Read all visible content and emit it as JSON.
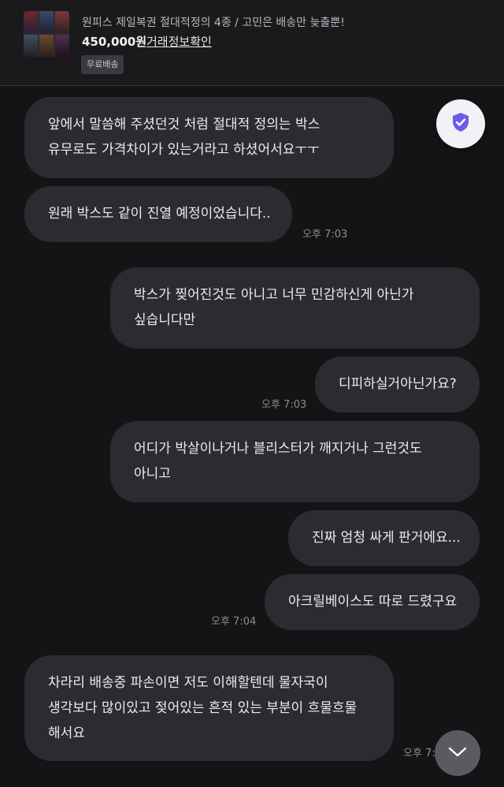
{
  "product": {
    "title": "원피스 제일복권 절대적정의 4종 / 고민은 배송만 늦출뿐!",
    "price": "450,000원",
    "transaction_link": "거래정보확인",
    "badge": "무료배송"
  },
  "messages": [
    {
      "side": "received",
      "lines": [
        "앞에서 말씀해 주셨던것 처럼 절대적 정의는 박스",
        "유무로도 가격차이가 있는거라고 하셨어서요ㅜㅜ"
      ]
    },
    {
      "side": "received",
      "lines": [
        "원래 박스도 같이 진열 예정이었습니다.."
      ],
      "time": "오후 7:03"
    },
    {
      "side": "sent",
      "lines": [
        "박스가 찢어진것도 아니고 너무 민감하신게 아닌가",
        "싶습니다만"
      ]
    },
    {
      "side": "sent",
      "lines": [
        "디피하실거아닌가요?"
      ],
      "time": "오후 7:03"
    },
    {
      "side": "sent",
      "lines": [
        "어디가 박살이나거나 블리스터가 깨지거나 그런것도",
        "아니고"
      ]
    },
    {
      "side": "sent",
      "lines": [
        "진짜 엄청 싸게 판거에요..."
      ]
    },
    {
      "side": "sent",
      "lines": [
        "아크릴베이스도 따로 드렸구요"
      ],
      "time": "오후 7:04"
    },
    {
      "side": "received",
      "lines": [
        "차라리 배송중 파손이면 저도 이해할텐데 물자국이",
        "생각보다 많이있고 젖어있는 흔적 있는 부분이 흐물흐물",
        "해서요"
      ],
      "time": "오후 7:"
    }
  ],
  "icons": {
    "safety": "shield-check-icon",
    "scroll_down": "chevron-down-icon"
  },
  "colors": {
    "background": "#141416",
    "bubble": "#2c2c30",
    "shield_accent": "#6c5ce7"
  }
}
